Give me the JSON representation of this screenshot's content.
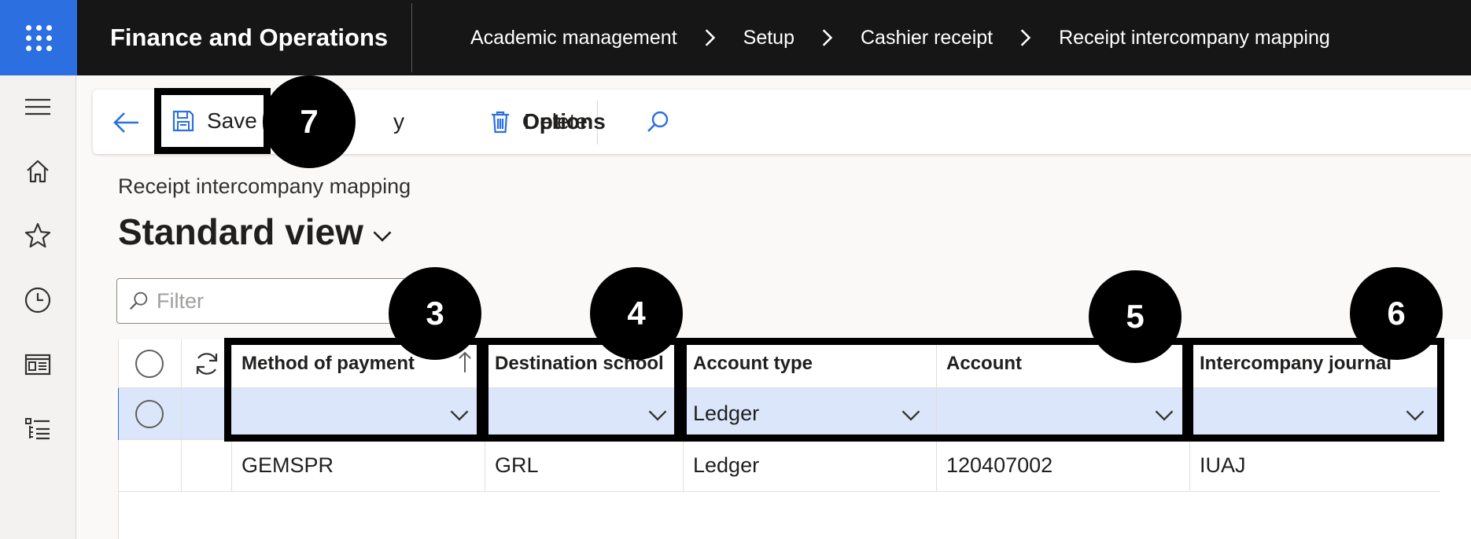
{
  "app": {
    "title": "Finance and Operations"
  },
  "breadcrumb": [
    "Academic management",
    "Setup",
    "Cashier receipt",
    "Receipt intercompany mapping"
  ],
  "action_pane": {
    "save_label": "Save",
    "delete_label": "Delete",
    "options_label": "Options",
    "hidden_partial": "y"
  },
  "page": {
    "caption": "Receipt intercompany mapping",
    "view_title": "Standard view"
  },
  "filter": {
    "placeholder": "Filter",
    "value": ""
  },
  "grid": {
    "columns": [
      "Method of payment",
      "Destination school",
      "Account type",
      "Account",
      "Intercompany journal"
    ],
    "rows": [
      {
        "method": "",
        "school": "",
        "account_type": "Ledger",
        "account": "",
        "journal": "",
        "selected": true
      },
      {
        "method": "GEMSPR",
        "school": "GRL",
        "account_type": "Ledger",
        "account": "120407002",
        "journal": "IUAJ",
        "selected": false
      }
    ]
  },
  "callouts": [
    "3",
    "4",
    "5",
    "6",
    "7"
  ],
  "colors": {
    "topbar": "#161616",
    "accent": "#2b6fe0",
    "selected_row": "#dbe6fa",
    "callout": "#000000"
  },
  "icons": [
    "app-launcher-icon",
    "hamburger-icon",
    "home-icon",
    "star-icon",
    "clock-icon",
    "workspace-icon",
    "modules-list-icon",
    "back-arrow-icon",
    "save-icon",
    "trash-icon",
    "search-icon",
    "filter-search-icon",
    "refresh-icon",
    "sort-up-icon",
    "chevron-down-icon",
    "chevron-right-icon"
  ]
}
